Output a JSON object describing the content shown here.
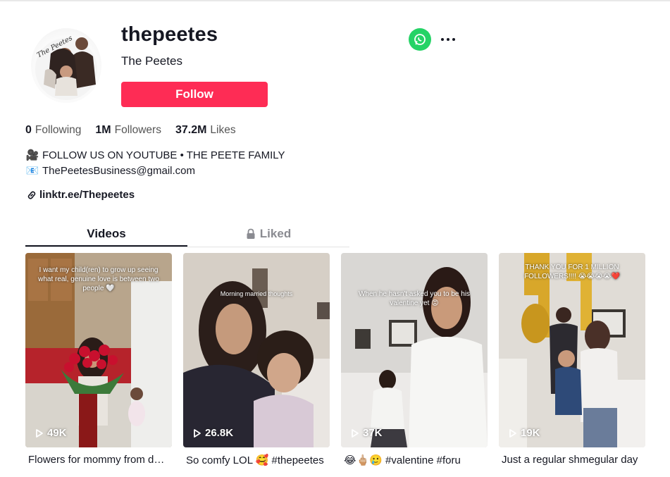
{
  "profile": {
    "username": "thepeetes",
    "nickname": "The Peetes",
    "follow_label": "Follow",
    "avatar_text": "The Peetes"
  },
  "stats": [
    {
      "value": "0",
      "label": "Following"
    },
    {
      "value": "1M",
      "label": "Followers"
    },
    {
      "value": "37.2M",
      "label": "Likes"
    }
  ],
  "bio": {
    "line1_emoji": "🎥",
    "line1": "FOLLOW US ON YOUTUBE • THE PEETE FAMILY",
    "line2_emoji": "📧",
    "line2": "ThePeetesBusiness@gmail.com",
    "link": "linktr.ee/Thepeetes"
  },
  "tabs": {
    "videos": "Videos",
    "liked": "Liked"
  },
  "icons": {
    "share": "whatsapp-icon",
    "more": "more-icon",
    "link": "link-icon",
    "lock": "lock-icon",
    "play": "play-icon"
  },
  "colors": {
    "accent": "#fe2c55",
    "whatsapp": "#25d366",
    "text": "#161823"
  },
  "videos": [
    {
      "overlay": "I want my child(ren) to grow up seeing what real, genuine love is between two people 🤍",
      "views": "49K",
      "caption": "Flowers for mommy from daddy"
    },
    {
      "overlay": "Morning married thoughts",
      "views": "26.8K",
      "caption": "So comfy LOL 🥰 #thepeetes"
    },
    {
      "overlay": "When he hasn't asked you to be his valentine yet 😡",
      "views": "37K",
      "caption": "😂🖕🏼🥲 #valentine #foru"
    },
    {
      "overlay": "THANK YOU FOR 1 MILLION FOLLOWERS!!!! 😭😭😭😭❤️",
      "views": "19K",
      "caption": "Just a regular shmegular day"
    }
  ]
}
